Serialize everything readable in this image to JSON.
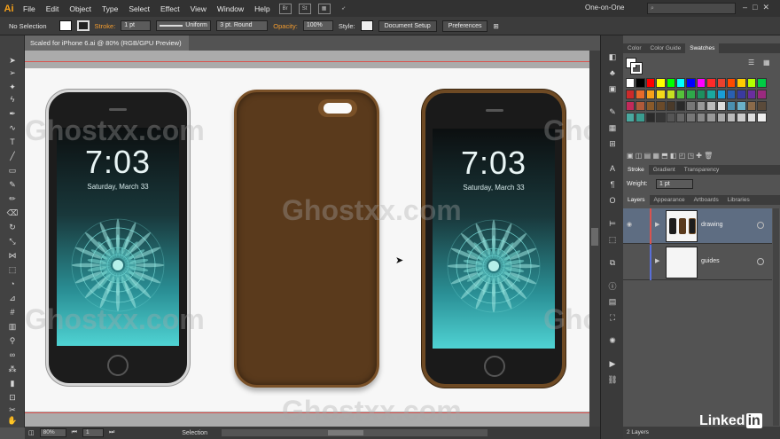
{
  "app": {
    "logo": "Ai"
  },
  "menu": [
    "File",
    "Edit",
    "Object",
    "Type",
    "Select",
    "Effect",
    "View",
    "Window",
    "Help"
  ],
  "menu_icons": [
    "Br",
    "St"
  ],
  "workspace": "One-on-One",
  "window_controls": [
    "–",
    "□",
    "✕"
  ],
  "control": {
    "selection": "No Selection",
    "stroke_label": "Stroke:",
    "stroke_weight": "1 pt",
    "stroke_profile": "Uniform",
    "brush": "3 pt. Round",
    "opacity_label": "Opacity:",
    "opacity": "100%",
    "style_label": "Style:",
    "document_setup": "Document Setup",
    "preferences": "Preferences"
  },
  "document": {
    "tab_title": "Scaled for iPhone 6.ai @ 80% (RGB/GPU Preview)",
    "watermark": "Ghostxx.com",
    "phone_time": "7:03",
    "phone_date": "Saturday, March 33"
  },
  "status": {
    "zoom": "80%",
    "page": "1",
    "tool": "Selection"
  },
  "panels": {
    "color_tabs": [
      "Color",
      "Color Guide",
      "Swatches"
    ],
    "stroke_tabs": [
      "Stroke",
      "Gradient",
      "Transparency"
    ],
    "weight_label": "Weight:",
    "weight_value": "1 pt",
    "layer_tabs": [
      "Layers",
      "Appearance",
      "Artboards",
      "Libraries"
    ],
    "layers": [
      {
        "name": "drawing",
        "color": "#d9534f"
      },
      {
        "name": "guides",
        "color": "#5a6fd8"
      }
    ],
    "layer_count": "2 Layers"
  },
  "swatch_colors": [
    "#ffffff",
    "#000000",
    "#ff0000",
    "#ffff00",
    "#00ff00",
    "#00ffff",
    "#0000ff",
    "#ff00ff",
    "#ff2a2a",
    "#e9412f",
    "#ff4b00",
    "#ffcc00",
    "#b3ff00",
    "#00cc44",
    "#cc2a2a",
    "#e86a2a",
    "#f7a11a",
    "#f3d91a",
    "#c6e021",
    "#55c23a",
    "#2ea84a",
    "#1e8f5f",
    "#1aa9a0",
    "#1a9dd6",
    "#2a5fb0",
    "#3a3a9f",
    "#6a2e9f",
    "#9a2a7f",
    "#c22a5a",
    "#b05a3a",
    "#8a5a2a",
    "#6a4a2a",
    "#4a3a2a",
    "#2a2a2a",
    "#777777",
    "#999999",
    "#bbbbbb",
    "#dddddd",
    "#4a8fb0",
    "#6ab0c9",
    "#8a6a4a",
    "#5a4a3a",
    "#4aa9a0",
    "#3a9d90",
    "#2a2a2a",
    "#353535",
    "#555555",
    "#666666",
    "#777777",
    "#888888",
    "#999999",
    "#aaaaaa",
    "#bbbbbb",
    "#cccccc",
    "#dddddd",
    "#eeeeee"
  ],
  "colors": {
    "case_brown": "#5a3a1c",
    "case_edge": "#7a5128",
    "accent_orange": "#f39c2f"
  }
}
